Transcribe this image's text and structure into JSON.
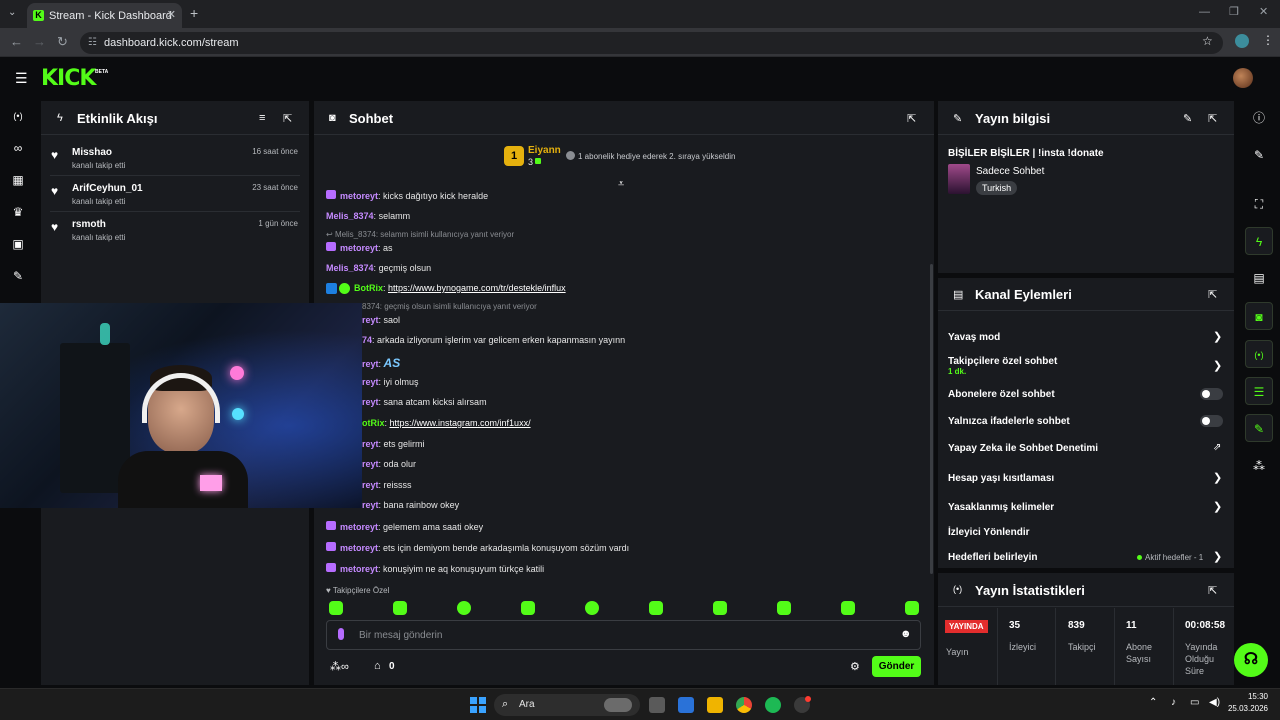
{
  "browser": {
    "tab_title": "Stream - Kick Dashboard",
    "url": "dashboard.kick.com/stream"
  },
  "app": {
    "logo": "KICK",
    "logo_badge": "BETA"
  },
  "activity": {
    "title": "Etkinlik Akışı",
    "items": [
      {
        "name": "Misshao",
        "action": "kanalı takip etti",
        "time": "16 saat önce"
      },
      {
        "name": "ArifCeyhun_01",
        "action": "kanalı takip etti",
        "time": "23 saat önce"
      },
      {
        "name": "rsmoth",
        "action": "kanalı takip etti",
        "time": "1 gün önce"
      }
    ]
  },
  "chat": {
    "title": "Sohbet",
    "pinned_user": "Eiyann",
    "pinned_rank": "1",
    "pinned_count": "3",
    "pinned_message": "1 abonelik hediye ederek 2. sıraya yükseldin",
    "messages": [
      {
        "user": "metoreyt",
        "text": "kicks dağıtıyo kick heralde"
      },
      {
        "user": "Melis_8374",
        "text": "selamm"
      },
      {
        "reply": "Melis_8374: selamm isimli kullanıcıya yanıt veriyor"
      },
      {
        "user": "metoreyt",
        "text": "as"
      },
      {
        "user": "Melis_8374",
        "text": "geçmiş olsun"
      },
      {
        "user": "BotRix",
        "link": "https://www.bynogame.com/tr/destekle/influx"
      },
      {
        "reply": "8374: geçmiş olsun isimli kullanıcıya yanıt veriyor"
      },
      {
        "user": "reyt",
        "text": "saol"
      },
      {
        "user": "74",
        "text": "arkada izliyorum işlerim var gelicem erken kapanmasın yayınn"
      },
      {
        "user": "reyt",
        "text": ""
      },
      {
        "user": "reyt",
        "text": "iyi olmuş"
      },
      {
        "user": "reyt",
        "text": "sana atcam kicksi alırsam"
      },
      {
        "user": "otRix",
        "link": "https://www.instagram.com/inf1uxx/"
      },
      {
        "user": "reyt",
        "text": "ets gelirmi"
      },
      {
        "user": "reyt",
        "text": "oda olur"
      },
      {
        "user": "reyt",
        "text": "reissss"
      },
      {
        "user": "reyt",
        "text": "bana rainbow okey"
      },
      {
        "user": "metoreyt",
        "text": "gelemem ama saati okey"
      },
      {
        "user": "metoreyt",
        "text": "ets için demiyom bende arkadaşımla konuşuyom sözüm vardı"
      },
      {
        "user": "metoreyt",
        "text": "konuşiyim ne aq konuşuyum türkçe katili"
      }
    ],
    "emote_text": "AS",
    "followers_only": "Takipçilere Özel",
    "input_placeholder": "Bir mesaj gönderin",
    "kicks_count": "0",
    "send_label": "Gönder"
  },
  "stream_info": {
    "title": "Yayın bilgisi",
    "stream_title": "BİŞİLER BİŞİLER | !insta !donate",
    "category": "Sadece Sohbet",
    "language_tag": "Turkish"
  },
  "channel_actions": {
    "title": "Kanal Eylemleri",
    "rows": [
      {
        "label": "Yavaş mod"
      },
      {
        "label": "Takipçilere özel sohbet",
        "sub": "1 dk."
      },
      {
        "label": "Abonelere özel sohbet"
      },
      {
        "label": "Yalnızca ifadelerle sohbet"
      },
      {
        "label": "Yapay Zeka ile Sohbet Denetimi"
      },
      {
        "label": "Hesap yaşı kısıtlaması"
      },
      {
        "label": "Yasaklanmış kelimeler"
      },
      {
        "label": "İzleyici Yönlendir"
      },
      {
        "label": "Hedefleri belirleyin",
        "extra": "Aktif hedefler - 1"
      }
    ]
  },
  "stream_stats": {
    "title": "Yayın İstatistikleri",
    "live_badge": "YAYINDA",
    "live_label": "Yayın",
    "viewers_value": "35",
    "viewers_label": "İzleyici",
    "followers_value": "839",
    "followers_label": "Takipçi",
    "subs_value": "11",
    "subs_label": "Abone Sayısı",
    "duration_value": "00:08:58",
    "duration_label": "Yayında Olduğu Süre"
  },
  "taskbar": {
    "search_label": "Ara",
    "time": "15:30",
    "date": "25.03.2026"
  },
  "colors": {
    "kick_green": "#53fc18",
    "panel_bg": "#191b1f",
    "page_bg": "#0b0c0e",
    "username_purple": "#c58aff",
    "live_red": "#e32d2d"
  }
}
